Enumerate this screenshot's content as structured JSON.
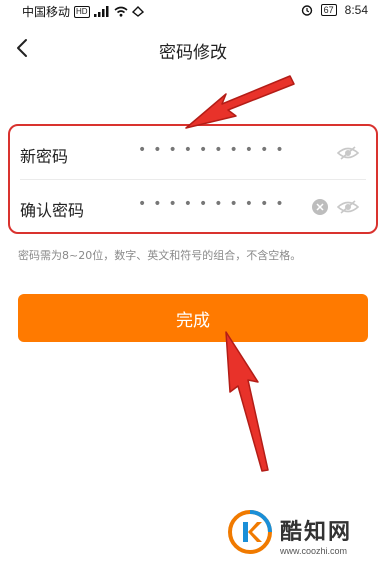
{
  "status_bar": {
    "carrier": "中国移动",
    "hd": "HD",
    "battery": "67",
    "time": "8:54"
  },
  "nav": {
    "title": "密码修改"
  },
  "form": {
    "new_password": {
      "label": "新密码",
      "value": "••••••••••"
    },
    "confirm_password": {
      "label": "确认密码",
      "value": "••••••••••"
    }
  },
  "hint": "密码需为8~20位，数字、英文和符号的组合，不含空格。",
  "submit_label": "完成",
  "watermark": {
    "name": "酷知网",
    "url": "www.coozhi.com"
  },
  "colors": {
    "accent": "#ff7a00",
    "highlight": "#d9322e"
  }
}
